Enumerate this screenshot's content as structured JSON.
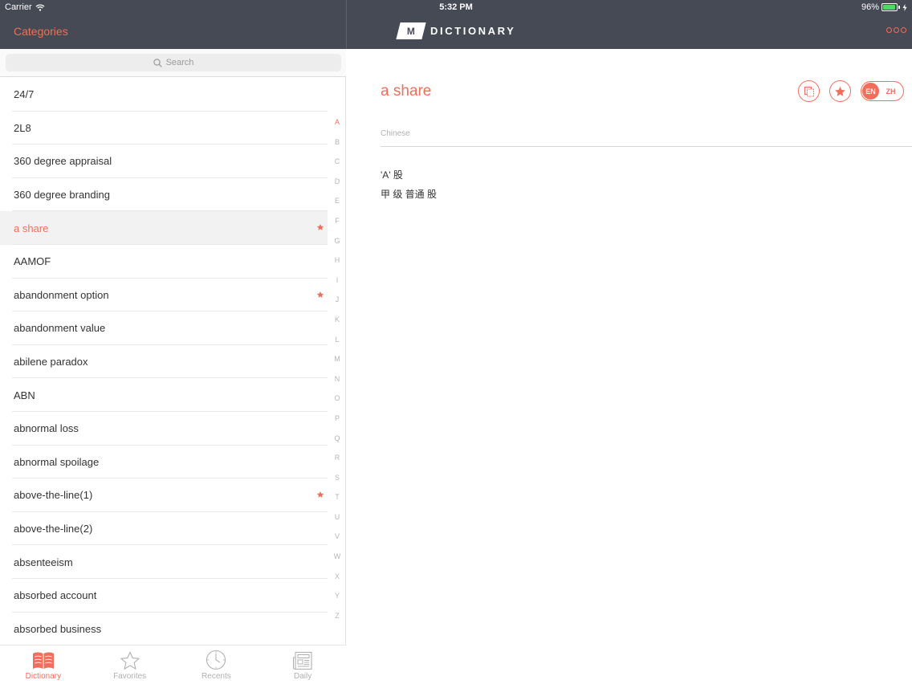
{
  "status_bar": {
    "carrier": "Carrier",
    "time": "5:32 PM",
    "battery": "96%",
    "battery_level": 0.96
  },
  "header": {
    "categories_label": "Categories",
    "logo_badge": "M",
    "logo_text": "DICTIONARY"
  },
  "search": {
    "placeholder": "Search"
  },
  "list": {
    "items": [
      {
        "label": "24/7",
        "favorite": false,
        "selected": false
      },
      {
        "label": "2L8",
        "favorite": false,
        "selected": false
      },
      {
        "label": "360 degree appraisal",
        "favorite": false,
        "selected": false
      },
      {
        "label": "360 degree branding",
        "favorite": false,
        "selected": false
      },
      {
        "label": "a share",
        "favorite": true,
        "selected": true
      },
      {
        "label": "AAMOF",
        "favorite": false,
        "selected": false
      },
      {
        "label": "abandonment option",
        "favorite": true,
        "selected": false
      },
      {
        "label": "abandonment value",
        "favorite": false,
        "selected": false
      },
      {
        "label": "abilene paradox",
        "favorite": false,
        "selected": false
      },
      {
        "label": "ABN",
        "favorite": false,
        "selected": false
      },
      {
        "label": "abnormal loss",
        "favorite": false,
        "selected": false
      },
      {
        "label": "abnormal spoilage",
        "favorite": false,
        "selected": false
      },
      {
        "label": "above-the-line(1)",
        "favorite": true,
        "selected": false
      },
      {
        "label": "above-the-line(2)",
        "favorite": false,
        "selected": false
      },
      {
        "label": "absenteeism",
        "favorite": false,
        "selected": false
      },
      {
        "label": "absorbed account",
        "favorite": false,
        "selected": false
      },
      {
        "label": "absorbed business",
        "favorite": false,
        "selected": false
      }
    ]
  },
  "index_letters": [
    "A",
    "B",
    "C",
    "D",
    "E",
    "F",
    "G",
    "H",
    "I",
    "J",
    "K",
    "L",
    "M",
    "N",
    "O",
    "P",
    "Q",
    "R",
    "S",
    "T",
    "U",
    "V",
    "W",
    "X",
    "Y",
    "Z"
  ],
  "index_active": "A",
  "tabs": [
    {
      "label": "Dictionary",
      "icon": "book-icon",
      "active": true
    },
    {
      "label": "Favorites",
      "icon": "star-outline-icon",
      "active": false
    },
    {
      "label": "Recents",
      "icon": "clock-icon",
      "active": false
    },
    {
      "label": "Daily",
      "icon": "newspaper-icon",
      "active": false
    }
  ],
  "detail": {
    "title": "a share",
    "lang_active": "EN",
    "lang_inactive": "ZH",
    "section_label": "Chinese",
    "definition_lines": [
      "'A' 股",
      "甲 级 普通 股"
    ]
  },
  "colors": {
    "accent": "#f06e5a",
    "header_bg": "#454a55",
    "selected_row": "#f2f2f2"
  }
}
